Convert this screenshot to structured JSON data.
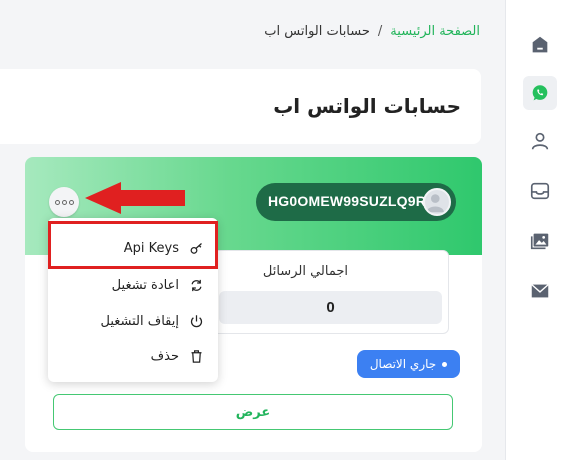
{
  "breadcrumb": {
    "home": "الصفحة الرئيسية",
    "separator": "/",
    "current": "حسابات الواتس اب"
  },
  "page": {
    "title": "حسابات الواتس اب"
  },
  "sidebar": {
    "items": [
      {
        "icon": "home-icon",
        "active": false
      },
      {
        "icon": "whatsapp-icon",
        "active": true
      },
      {
        "icon": "user-icon",
        "active": false
      },
      {
        "icon": "inbox-icon",
        "active": false
      },
      {
        "icon": "gallery-icon",
        "active": false
      },
      {
        "icon": "mail-icon",
        "active": false
      }
    ]
  },
  "account": {
    "id": "HG0OMEW99SUZLQ9R",
    "stats_label": "اجمالي الرسائل",
    "stats_value": "0",
    "status": "جاري الاتصال",
    "view_label": "عرض"
  },
  "menu": {
    "items": [
      {
        "label": "Api Keys",
        "icon": "key-icon"
      },
      {
        "label": "اعادة تشغيل",
        "icon": "restart-icon"
      },
      {
        "label": "إيقاف التشغيل",
        "icon": "power-icon"
      },
      {
        "label": "حذف",
        "icon": "trash-icon"
      }
    ]
  },
  "colors": {
    "accent": "#21b45a",
    "header_dark": "#1e6b47",
    "status_blue": "#3c80f2",
    "highlight_red": "#e02020"
  }
}
